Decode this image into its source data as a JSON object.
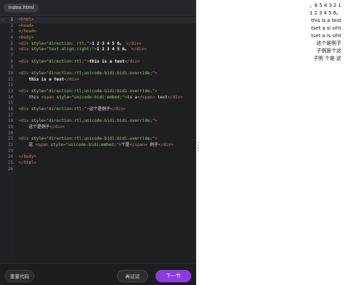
{
  "tab": {
    "label": "index.html"
  },
  "editor": {
    "lines": [
      {
        "n": "1",
        "html": "<span class=\"tag\">&lt;html&gt;</span>"
      },
      {
        "n": "2",
        "html": "<span class=\"tag\">&lt;head&gt;</span>"
      },
      {
        "n": "3",
        "html": "<span class=\"tag\">&lt;/head&gt;</span>"
      },
      {
        "n": "4",
        "html": "<span class=\"tag\">&lt;body&gt;</span>"
      },
      {
        "n": "5",
        "html": "<span class=\"tag\">&lt;div </span><span class=\"attr\">style</span><span class=\"tag\">=</span><span class=\"str\">\"direction: rtl;\"</span><span class=\"tag\">&gt;</span><span class=\"bold\">1 2 3 4 5 6。</span><span class=\"tag\"> &lt;/div&gt;</span>"
      },
      {
        "n": "6",
        "html": "<span class=\"tag\">&lt;div </span><span class=\"attr\">style</span><span class=\"tag\">=</span><span class=\"str\">\"text-align:right;\"</span><span class=\"tag\">&gt;</span><span class=\"bold\">1 2 3 4 5 6。</span><span class=\"tag\"> &lt;/div&gt;</span>"
      },
      {
        "n": "7",
        "html": ""
      },
      {
        "n": "8",
        "html": "<span class=\"tag\">&lt;div </span><span class=\"attr\">style</span><span class=\"tag\">=</span><span class=\"str\">\"direction:rtl;\"</span><span class=\"tag\">&gt;</span><span class=\"bold\">this is a test</span><span class=\"tag\">&lt;/div&gt;</span>"
      },
      {
        "n": "9",
        "html": ""
      },
      {
        "n": "10",
        "html": "<span class=\"tag\">&lt;div </span><span class=\"attr\">style</span><span class=\"tag\">=</span><span class=\"str\">\"direction:rtl;unicode-bidi:bidi-override;\"</span><span class=\"tag\">&gt;</span>"
      },
      {
        "n": "11",
        "html": "    <span class=\"bold\">this is a test</span><span class=\"tag\">&lt;/div&gt;</span>"
      },
      {
        "n": "12",
        "html": ""
      },
      {
        "n": "13",
        "html": "<span class=\"tag\">&lt;div </span><span class=\"attr\">style</span><span class=\"tag\">=</span><span class=\"str\">\"direction:rtl;unicode-bidi:bidi-override;\"</span><span class=\"tag\">&gt;</span>"
      },
      {
        "n": "14",
        "html": "    <span class=\"plain\">this </span><span class=\"tag\">&lt;span </span><span class=\"attr\">style</span><span class=\"tag\">=</span><span class=\"str\">\"unicode-bidi:embed;\"</span><span class=\"tag\">&gt;</span><span class=\"plain\">is a</span><span class=\"tag\">&lt;/span&gt;</span><span class=\"plain\"> test</span><span class=\"tag\">&lt;/div&gt;</span>"
      },
      {
        "n": "15",
        "html": ""
      },
      {
        "n": "16",
        "html": "<span class=\"tag\">&lt;div </span><span class=\"attr\">style</span><span class=\"tag\">=</span><span class=\"str\">\"direction:rtl;\"</span><span class=\"tag\">&gt;</span><span class=\"plain\">这个是例子</span><span class=\"tag\">&lt;/div&gt;</span>"
      },
      {
        "n": "17",
        "html": ""
      },
      {
        "n": "18",
        "html": "<span class=\"tag\">&lt;div </span><span class=\"attr\">style</span><span class=\"tag\">=</span><span class=\"str\">\"direction:rtl;unicode-bidi:bidi-override;\"</span><span class=\"tag\">&gt;</span>"
      },
      {
        "n": "19",
        "html": "    <span class=\"plain\">这个是例子</span><span class=\"tag\">&lt;/div&gt;</span>"
      },
      {
        "n": "20",
        "html": ""
      },
      {
        "n": "21",
        "html": "<span class=\"tag\">&lt;div </span><span class=\"attr\">style</span><span class=\"tag\">=</span><span class=\"str\">\"direction:rtl;unicode-bidi:bidi-override;\"</span><span class=\"tag\">&gt;</span>"
      },
      {
        "n": "22",
        "html": "    <span class=\"plain\">这 </span><span class=\"tag\">&lt;span </span><span class=\"attr\">style</span><span class=\"tag\">=</span><span class=\"str\">\"unicode-bidi:embed;\"</span><span class=\"tag\">&gt;</span><span class=\"plain\">个是</span><span class=\"tag\">&lt;/span&gt;</span><span class=\"plain\"> 例子</span><span class=\"tag\">&lt;/div&gt;</span>"
      },
      {
        "n": "23",
        "html": ""
      },
      {
        "n": "24",
        "html": "<span class=\"tag\">&lt;/body&gt;</span>"
      },
      {
        "n": "25",
        "html": "<span class=\"tag\">&lt;/html&gt;</span>"
      },
      {
        "n": "26",
        "html": ""
      }
    ]
  },
  "buttons": {
    "reset": "重置代码",
    "try": "再试试",
    "next": "下一节"
  },
  "preview": {
    "lines": [
      "。6 5 4 3 2 1",
      "1 2 3 4 5 6。",
      "this is a test",
      "tset a si siht",
      "tset a is siht",
      "这个是例子",
      "子例是个这",
      "子例 个是 这"
    ]
  },
  "colors": {
    "editor_bg": "#1e1f21",
    "accent": "#8f3ae0"
  }
}
